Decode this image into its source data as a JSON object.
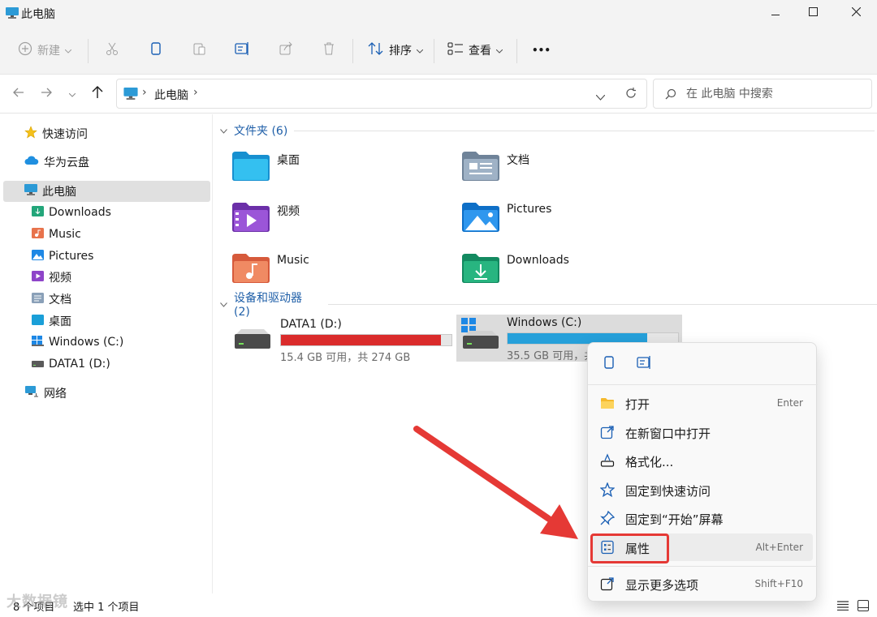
{
  "window": {
    "title": "此电脑"
  },
  "toolbar": {
    "new_label": "新建",
    "sort_label": "排序",
    "view_label": "查看",
    "more_label": "•••"
  },
  "address": {
    "crumb": "此电脑"
  },
  "search": {
    "placeholder": "在 此电脑 中搜索"
  },
  "sidebar": {
    "items": [
      {
        "label": "快速访问"
      },
      {
        "label": "华为云盘"
      },
      {
        "label": "此电脑"
      },
      {
        "label": "Downloads"
      },
      {
        "label": "Music"
      },
      {
        "label": "Pictures"
      },
      {
        "label": "视频"
      },
      {
        "label": "文档"
      },
      {
        "label": "桌面"
      },
      {
        "label": "Windows (C:)"
      },
      {
        "label": "DATA1 (D:)"
      },
      {
        "label": "网络"
      }
    ]
  },
  "folders": {
    "header": "文件夹 (6)",
    "items": [
      {
        "label": "桌面"
      },
      {
        "label": "文档"
      },
      {
        "label": "视频"
      },
      {
        "label": "Pictures"
      },
      {
        "label": "Music"
      },
      {
        "label": "Downloads"
      }
    ]
  },
  "drives": {
    "header": "设备和驱动器 (2)",
    "items": [
      {
        "name": "DATA1 (D:)",
        "info": "15.4 GB 可用，共 274 GB",
        "used_fraction": 0.94,
        "color": "#da2b2b"
      },
      {
        "name": "Windows (C:)",
        "info": "35.5 GB 可用，共",
        "used_fraction": 0.82,
        "color": "#26a0da"
      }
    ]
  },
  "context_menu": {
    "items": [
      {
        "label": "打开",
        "shortcut": "Enter"
      },
      {
        "label": "在新窗口中打开",
        "shortcut": ""
      },
      {
        "label": "格式化...",
        "shortcut": ""
      },
      {
        "label": "固定到快速访问",
        "shortcut": ""
      },
      {
        "label": "固定到“开始”屏幕",
        "shortcut": ""
      },
      {
        "label": "属性",
        "shortcut": "Alt+Enter"
      },
      {
        "label": "显示更多选项",
        "shortcut": "Shift+F10"
      }
    ]
  },
  "status": {
    "count": "8 个项目",
    "selected": "选中 1 个项目"
  },
  "colors": {
    "accent": "#0067c0",
    "annotation": "#e53935"
  }
}
